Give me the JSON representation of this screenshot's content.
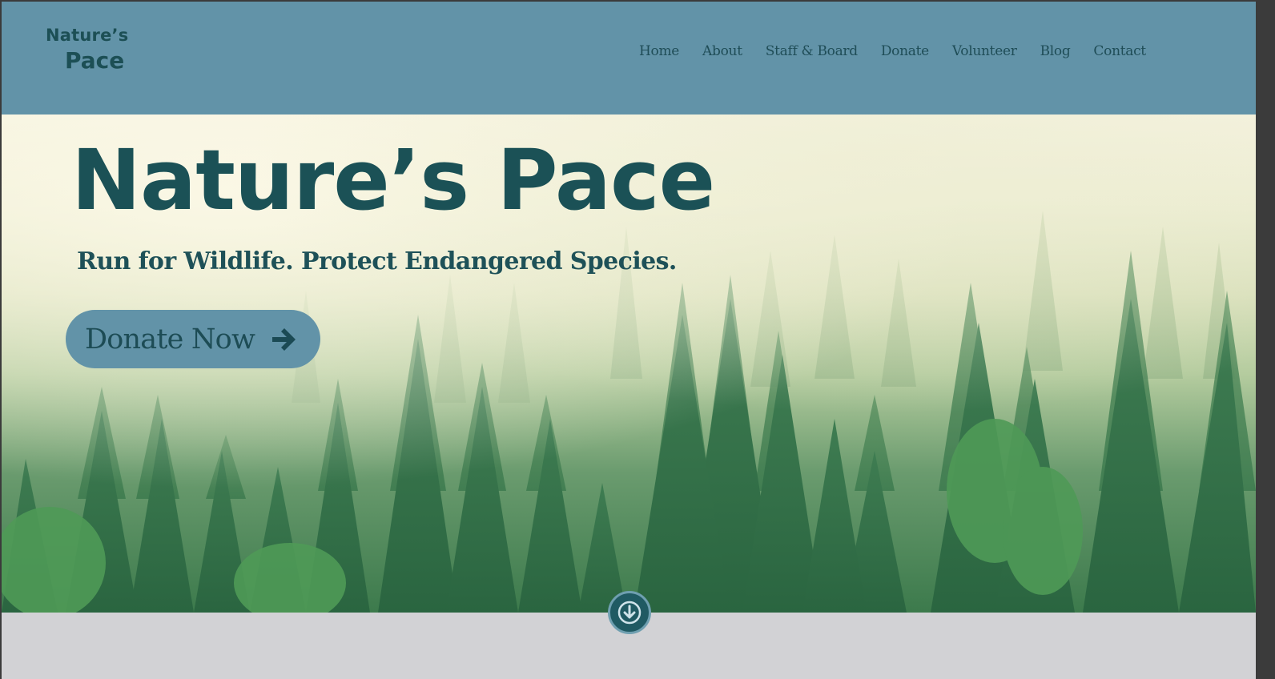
{
  "brand": {
    "line1": "Nature’s",
    "line2": "Pace"
  },
  "nav": {
    "items": [
      {
        "label": "Home"
      },
      {
        "label": "About"
      },
      {
        "label": "Staff & Board"
      },
      {
        "label": "Donate"
      },
      {
        "label": "Volunteer"
      },
      {
        "label": "Blog"
      },
      {
        "label": "Contact"
      }
    ]
  },
  "hero": {
    "title": "Nature’s Pace",
    "subtitle": "Run for Wildlife. Protect Endangered Species.",
    "cta_label": "Donate Now",
    "cta_icon": "arrow-right-icon",
    "background": "misty-pine-forest"
  },
  "scroll": {
    "icon": "arrow-down-circle-icon"
  },
  "colors": {
    "header_bg": "#6293a8",
    "text_dark_teal": "#1b5156",
    "button_bg": "#6293a8",
    "footer_bg": "#d2d2d5"
  }
}
